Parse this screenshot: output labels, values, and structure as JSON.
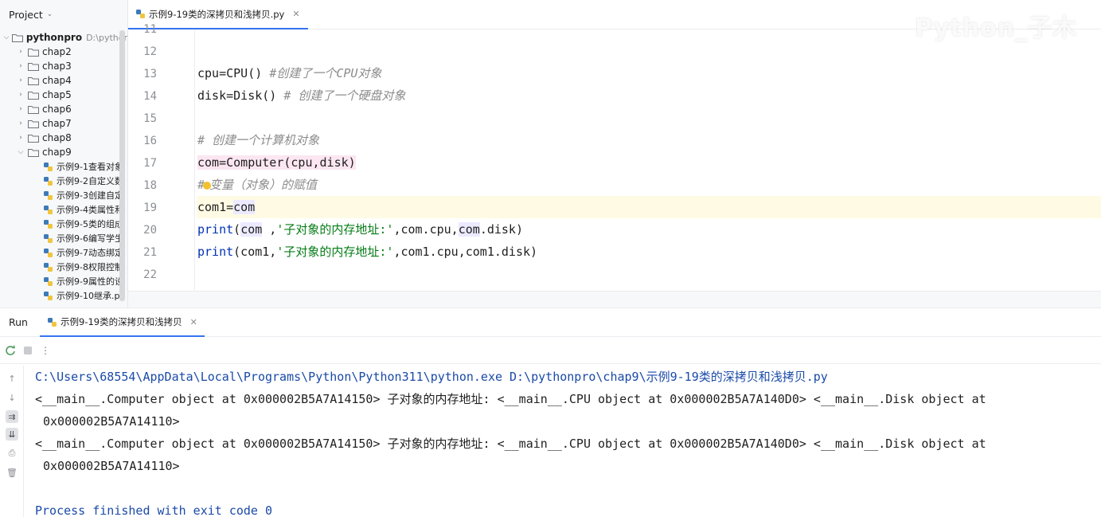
{
  "project": {
    "title": "Project",
    "root": {
      "name": "pythonpro",
      "path_hint": "D:\\pythor"
    },
    "folders": [
      "chap2",
      "chap3",
      "chap4",
      "chap5",
      "chap6",
      "chap7",
      "chap8",
      "chap9"
    ],
    "files": [
      "示例9-1查看对象",
      "示例9-2自定义数",
      "示例9-3创建自定",
      "示例9-4类属性和",
      "示例9-5类的组成",
      "示例9-6编写学生",
      "示例9-7动态绑定",
      "示例9-8权限控制",
      "示例9-9属性的设",
      "示例9-10继承.py"
    ]
  },
  "editor": {
    "tab_label": "示例9-19类的深拷贝和浅拷贝.py",
    "watermark": "Python_子木",
    "line_numbers": [
      "11",
      "12",
      "13",
      "14",
      "15",
      "16",
      "17",
      "18",
      "19",
      "20",
      "21",
      "22"
    ],
    "code": {
      "l13_code": "cpu=CPU() ",
      "l13_comment": "#创建了一个CPU对象",
      "l14_code": "disk=Disk() ",
      "l14_comment": "# 创建了一个硬盘对象",
      "l16_comment": "# 创建一个计算机对象",
      "l17_code": "com=Computer(cpu,disk)",
      "l18_comment_a": "#",
      "l18_comment_b": "变量（对象）的赋值",
      "l19_a": "com1=",
      "l19_b": "com",
      "l20_print": "print",
      "l20_a": "(",
      "l20_com": "com",
      "l20_b": " ,",
      "l20_str": "'子对象的内存地址:'",
      "l20_c": ",com.cpu,",
      "l20_com2": "com",
      "l20_d": ".disk)",
      "l21_print": "print",
      "l21_a": "(com1,",
      "l21_str": "'子对象的内存地址:'",
      "l21_b": ",com1.cpu,com1.disk)"
    }
  },
  "run": {
    "title": "Run",
    "tab_label": "示例9-19类的深拷贝和浅拷贝",
    "console": [
      "C:\\Users\\68554\\AppData\\Local\\Programs\\Python\\Python311\\python.exe D:\\pythonpro\\chap9\\示例9-19类的深拷贝和浅拷贝.py",
      "<__main__.Computer object at 0x000002B5A7A14150> 子对象的内存地址: <__main__.CPU object at 0x000002B5A7A140D0> <__main__.Disk object at",
      "0x000002B5A7A14110>",
      "<__main__.Computer object at 0x000002B5A7A14150> 子对象的内存地址: <__main__.CPU object at 0x000002B5A7A140D0> <__main__.Disk object at",
      "0x000002B5A7A14110>",
      "",
      "Process finished with exit code 0"
    ]
  },
  "colors": {
    "accent": "#3574f0",
    "keyword": "#0033b3",
    "string": "#067d17",
    "comment": "#8c8c8c",
    "current_line": "#fffae3"
  }
}
